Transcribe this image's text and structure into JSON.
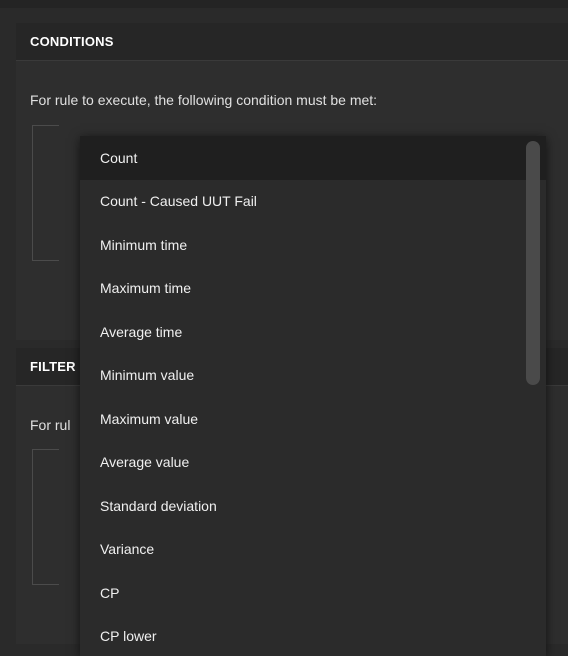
{
  "conditions": {
    "header": "CONDITIONS",
    "description": "For rule to execute, the following condition must be met:"
  },
  "filter": {
    "header": "FILTER",
    "description": "For rul"
  },
  "dropdown": {
    "items": [
      "Count",
      "Count - Caused UUT Fail",
      "Minimum time",
      "Maximum time",
      "Average time",
      "Minimum value",
      "Maximum value",
      "Average value",
      "Standard deviation",
      "Variance",
      "CP",
      "CP lower"
    ],
    "selected_index": 0
  }
}
